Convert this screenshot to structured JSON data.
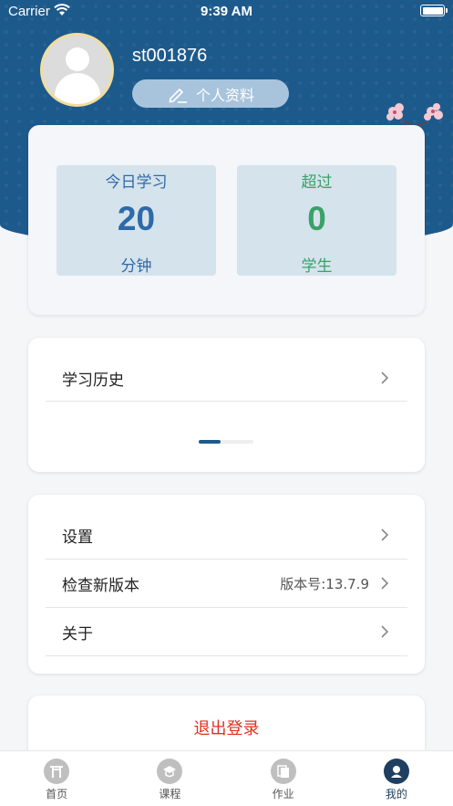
{
  "status_bar": {
    "carrier": "Carrier",
    "time": "9:39 AM"
  },
  "profile": {
    "username": "st001876",
    "edit_label": "个人资料"
  },
  "stats": {
    "study_label": "今日学习",
    "study_value": "20",
    "study_unit": "分钟",
    "exceed_label": "超过",
    "exceed_value": "0",
    "exceed_unit": "学生"
  },
  "history": {
    "label": "学习历史"
  },
  "settings": {
    "settings_label": "设置",
    "check_version_label": "检查新版本",
    "version_text": "版本号:13.7.9",
    "about_label": "关于"
  },
  "logout": {
    "label": "退出登录"
  },
  "tabbar": {
    "tabs": [
      {
        "label": "首页",
        "icon": "torii-icon"
      },
      {
        "label": "课程",
        "icon": "course-icon"
      },
      {
        "label": "作业",
        "icon": "homework-icon"
      },
      {
        "label": "我的",
        "icon": "profile-icon"
      }
    ],
    "active": "我的"
  },
  "colors": {
    "header": "#1d5a8c",
    "blue_text": "#2e6aa8",
    "green_text": "#3aa267",
    "logout": "#e0301e"
  }
}
